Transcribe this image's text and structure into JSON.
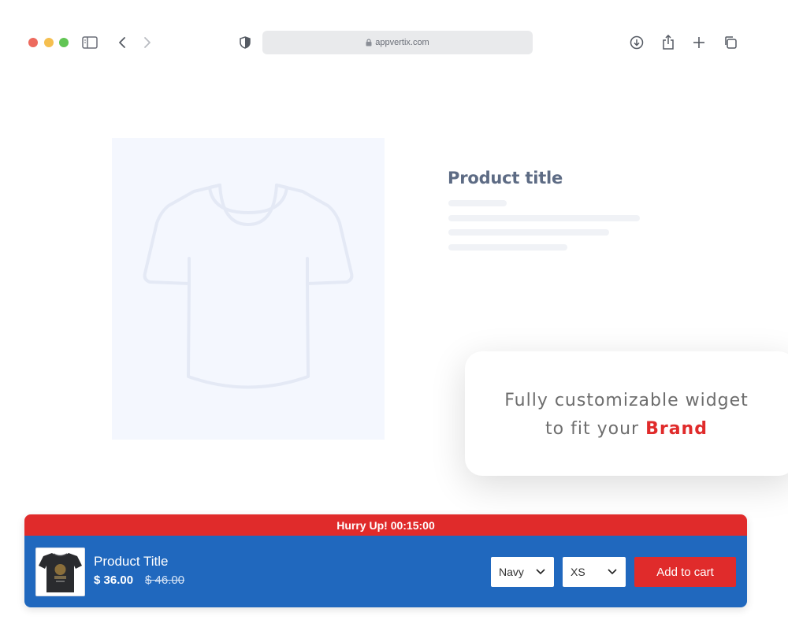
{
  "browser": {
    "url": "appvertix.com",
    "icons": [
      "sidebar-icon",
      "back-icon",
      "forward-icon",
      "shield-icon",
      "lock-icon",
      "download-icon",
      "share-icon",
      "new-tab-icon",
      "tabs-overview-icon"
    ]
  },
  "product": {
    "title": "Product title",
    "image_icon": "tshirt-placeholder-icon"
  },
  "callout": {
    "line1": "Fully customizable widget",
    "line2_prefix": "to fit your",
    "line2_highlight": "Brand"
  },
  "sticky_bar": {
    "timer_text": "Hurry Up! 00:15:00",
    "product_title": "Product Title",
    "price": "$ 36.00",
    "compare_price": "$ 46.00",
    "color_value": "Navy",
    "size_value": "XS",
    "add_to_cart_label": "Add to cart"
  },
  "colors": {
    "accent_red": "#e02b2b",
    "bar_blue": "#2068be",
    "title_slate": "#5d6b84"
  }
}
